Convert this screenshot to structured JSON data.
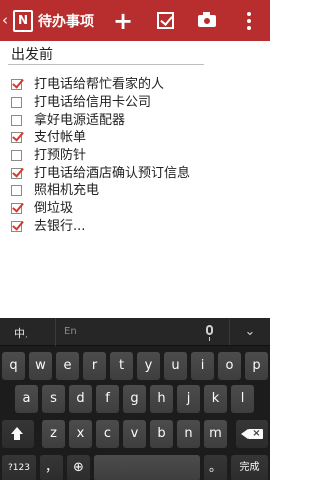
{
  "app_bar": {
    "title": "待办事项",
    "back_glyph": "‹",
    "add_glyph": "+",
    "icons": [
      "back-icon",
      "onenote-app-icon",
      "add-icon",
      "checkbox-icon",
      "camera-icon",
      "more-vert-icon"
    ],
    "color": "#b82d2d"
  },
  "note": {
    "title": "出发前",
    "items": [
      {
        "text": "打电话给帮忙看家的人",
        "checked": true
      },
      {
        "text": "打电话给信用卡公司",
        "checked": false
      },
      {
        "text": "拿好电源适配器",
        "checked": false
      },
      {
        "text": "支付帐单",
        "checked": true
      },
      {
        "text": "打预防针",
        "checked": false
      },
      {
        "text": "打电话给酒店确认预订信息",
        "checked": true
      },
      {
        "text": "照相机充电",
        "checked": false
      },
      {
        "text": "倒垃圾",
        "checked": true
      },
      {
        "text": "去银行...",
        "checked": true
      }
    ]
  },
  "keyboard": {
    "mode_label": "中",
    "mode_sub": ",",
    "lang_label": "En",
    "collapse_glyph": "⌄",
    "row1": [
      "q",
      "w",
      "e",
      "r",
      "t",
      "y",
      "u",
      "i",
      "o",
      "p"
    ],
    "row2": [
      "a",
      "s",
      "d",
      "f",
      "g",
      "h",
      "j",
      "k",
      "l"
    ],
    "row3": [
      "z",
      "x",
      "c",
      "v",
      "b",
      "n",
      "m"
    ],
    "symbols_label": "?123",
    "comma_label": "，",
    "globe_glyph": "⊕",
    "space_label": "",
    "period_label": "。",
    "done_label": "完成"
  }
}
